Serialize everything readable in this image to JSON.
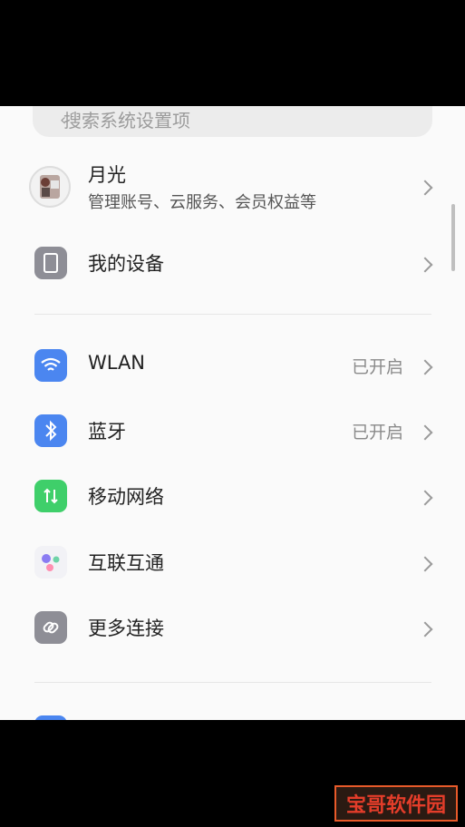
{
  "search": {
    "placeholder": "搜索系统设置项",
    "back_icon": "chevron-left-icon"
  },
  "account": {
    "name": "月光",
    "subtitle": "管理账号、云服务、会员权益等"
  },
  "settings": [
    {
      "id": "my-device",
      "label": "我的设备",
      "status": "",
      "icon": "device-icon",
      "color": "#8e8e96"
    },
    {
      "id": "wlan",
      "label": "WLAN",
      "status": "已开启",
      "icon": "wifi-icon",
      "color": "#4b86f0"
    },
    {
      "id": "bluetooth",
      "label": "蓝牙",
      "status": "已开启",
      "icon": "bluetooth-icon",
      "color": "#4b86f0"
    },
    {
      "id": "mobile-network",
      "label": "移动网络",
      "status": "",
      "icon": "mobile-data-icon",
      "color": "#3fcf6a"
    },
    {
      "id": "interconnect",
      "label": "互联互通",
      "status": "",
      "icon": "interconnect-icon",
      "color": "#f2f2f6"
    },
    {
      "id": "more-connections",
      "label": "更多连接",
      "status": "",
      "icon": "link-icon",
      "color": "#8e8e96"
    }
  ],
  "watermark": "宝哥软件园"
}
